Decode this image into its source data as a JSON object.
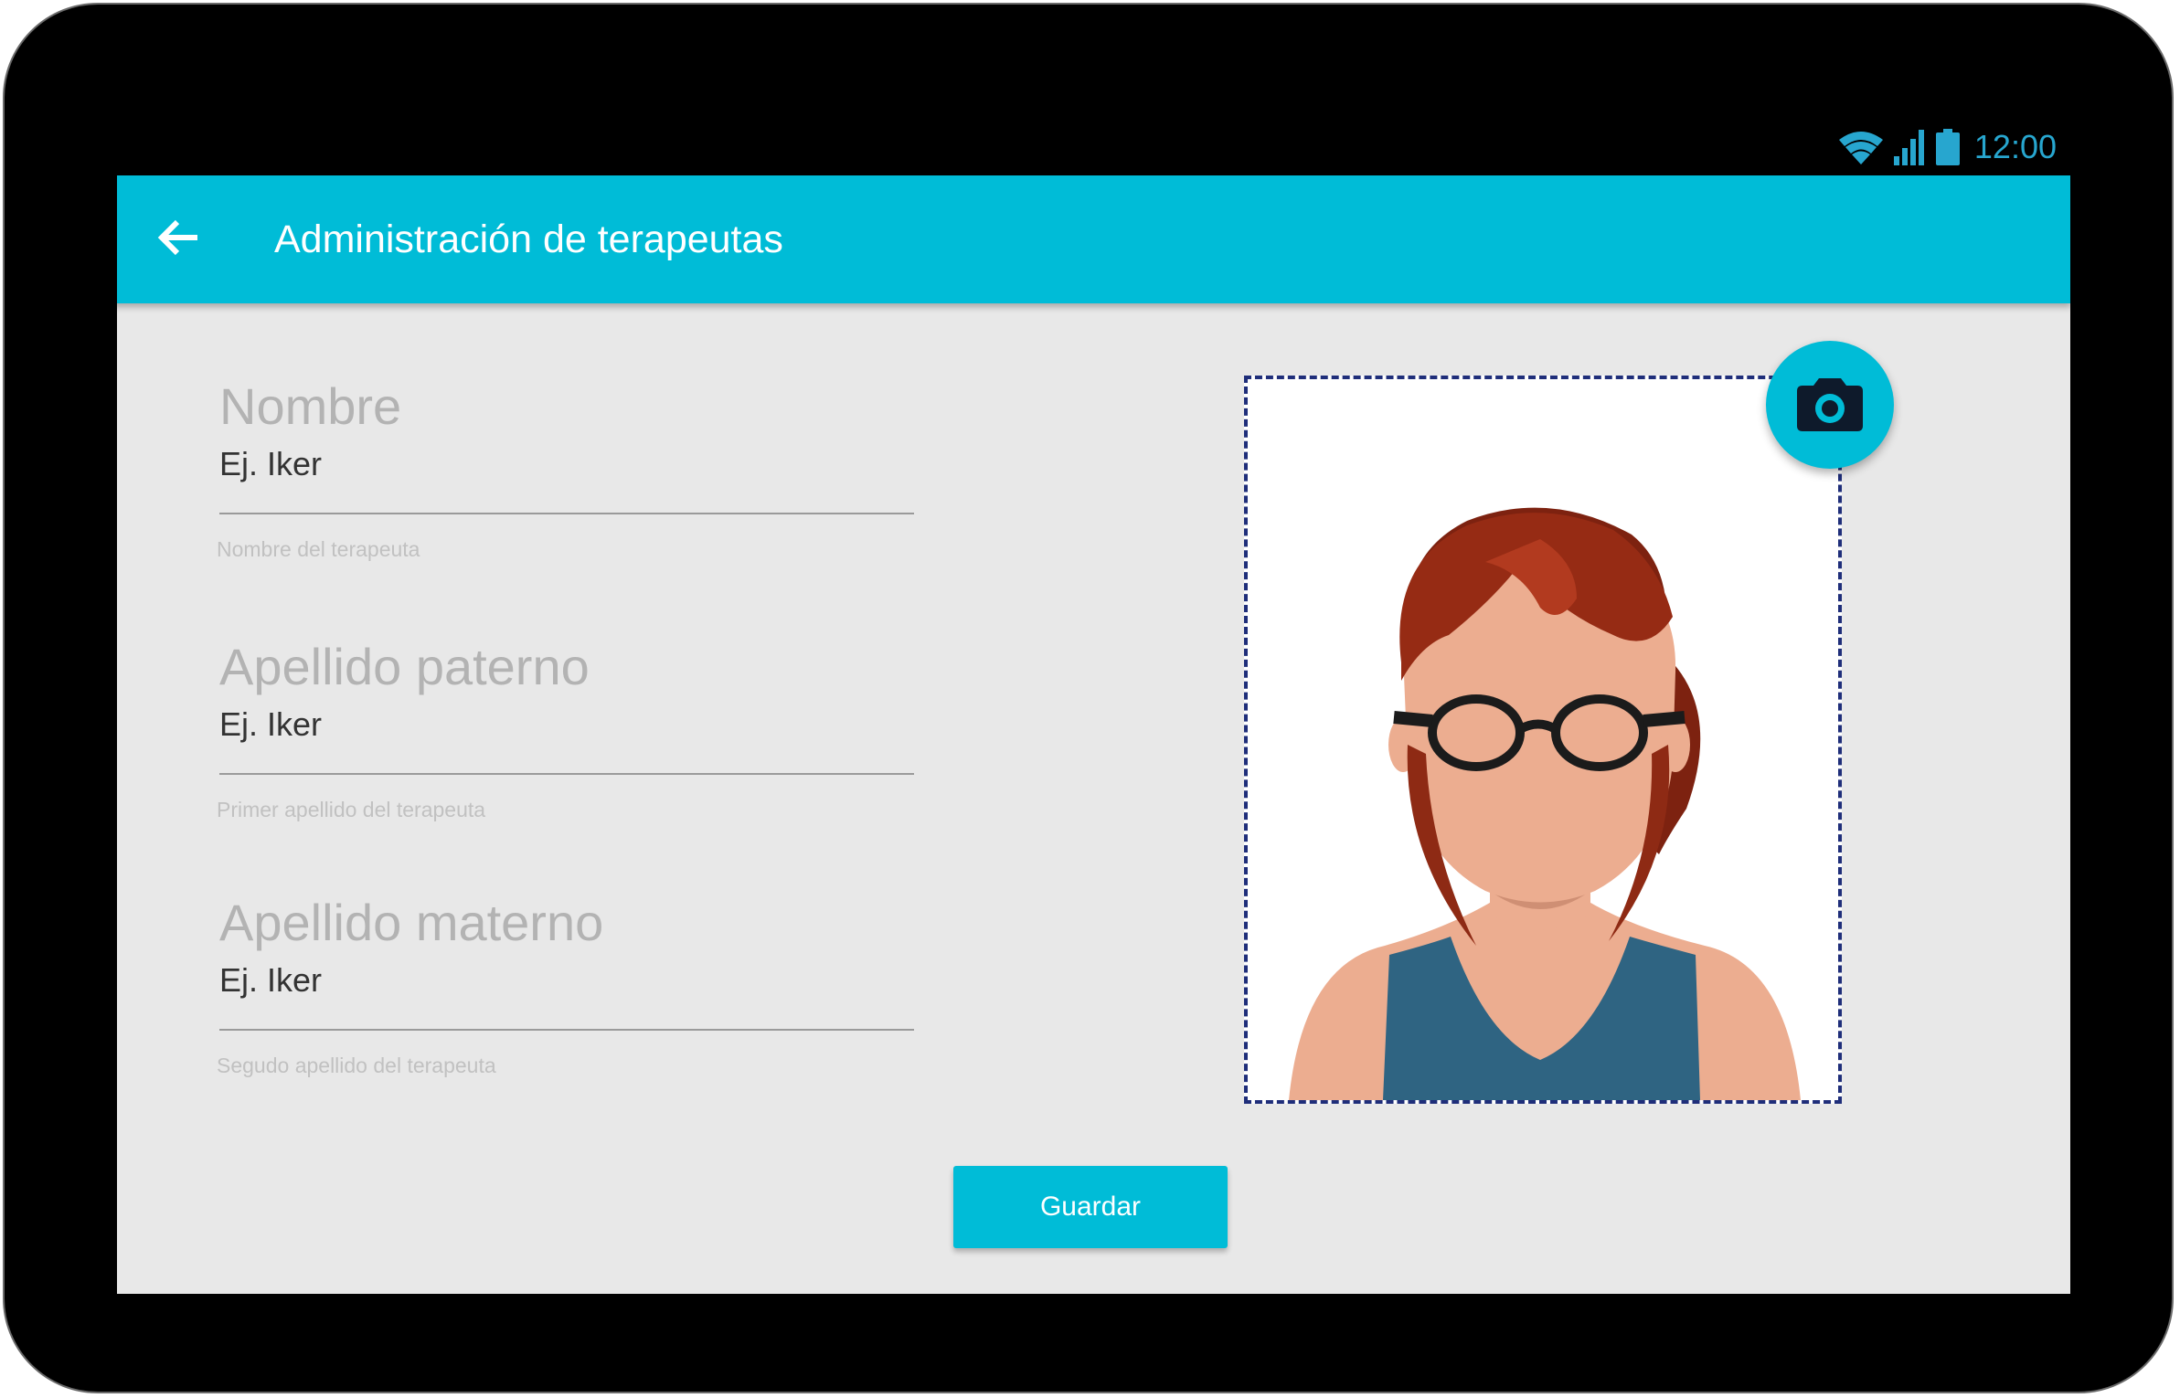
{
  "status_bar": {
    "time": "12:00",
    "icons": [
      "wifi-icon",
      "signal-icon",
      "battery-icon"
    ],
    "color": "#27a6cf"
  },
  "app_bar": {
    "title": "Administración de terapeutas",
    "back_icon": "arrow-back-icon",
    "color": "#00bcd7"
  },
  "form": {
    "fields": [
      {
        "label": "Nombre",
        "placeholder": "Ej. Iker",
        "value": "",
        "helper": "Nombre del terapeuta"
      },
      {
        "label": "Apellido paterno",
        "placeholder": "Ej. Iker",
        "value": "",
        "helper": "Primer apellido del terapeuta"
      },
      {
        "label": "Apellido materno",
        "placeholder": "Ej. Iker",
        "value": "",
        "helper": "Segudo apellido del terapeuta"
      }
    ],
    "save_label": "Guardar"
  },
  "photo": {
    "image": "therapist-avatar",
    "camera_icon": "camera-icon",
    "frame_color": "#1f2e7a"
  }
}
